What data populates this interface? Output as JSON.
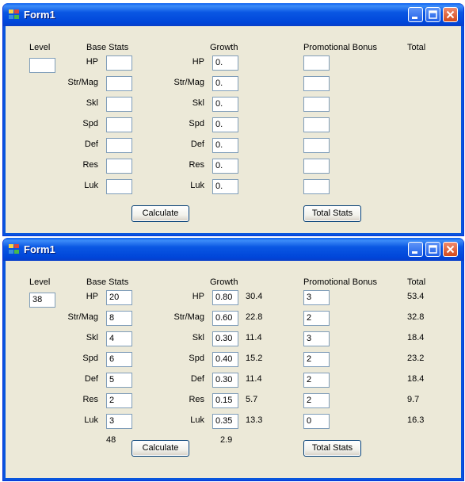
{
  "window_title": "Form1",
  "labels": {
    "level": "Level",
    "base_stats": "Base Stats",
    "growth": "Growth",
    "promotional_bonus": "Promotional Bonus",
    "total": "Total",
    "stats": [
      "HP",
      "Str/Mag",
      "Skl",
      "Spd",
      "Def",
      "Res",
      "Luk"
    ]
  },
  "buttons": {
    "calculate": "Calculate",
    "total_stats": "Total Stats"
  },
  "form_empty": {
    "level": "",
    "base": [
      "",
      "",
      "",
      "",
      "",
      "",
      ""
    ],
    "growth": [
      "0.",
      "0.",
      "0.",
      "0.",
      "0.",
      "0.",
      "0."
    ],
    "promo": [
      "",
      "",
      "",
      "",
      "",
      "",
      ""
    ]
  },
  "form_filled": {
    "level": "38",
    "base": [
      "20",
      "8",
      "4",
      "6",
      "5",
      "2",
      "3"
    ],
    "growth": [
      "0.80",
      "0.60",
      "0.30",
      "0.40",
      "0.30",
      "0.15",
      "0.35"
    ],
    "growth_result": [
      "30.4",
      "22.8",
      "11.4",
      "15.2",
      "11.4",
      "5.7",
      "13.3"
    ],
    "promo": [
      "3",
      "2",
      "3",
      "2",
      "2",
      "2",
      "0"
    ],
    "total": [
      "53.4",
      "32.8",
      "18.4",
      "23.2",
      "18.4",
      "9.7",
      "16.3"
    ],
    "base_sum": "48",
    "growth_sum": "2.9"
  },
  "colors": {
    "title_bar": "#0a57e3",
    "window_bg": "#ece9d8",
    "close_button": "#d44a1b"
  },
  "icons": [
    "app-icon",
    "minimize-icon",
    "maximize-icon",
    "close-icon"
  ]
}
